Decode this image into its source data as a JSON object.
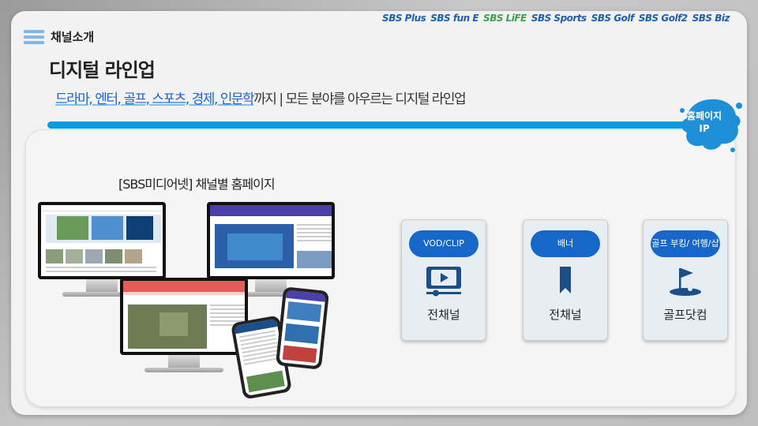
{
  "header": {
    "section_label": "채널소개",
    "title": "디지털 라인업",
    "subtitle_highlight": "드라마, 엔터, 골프, 스포츠, 경제, 인문학",
    "subtitle_rest": "까지 | 모든 분야를 아우르는 디지털 라인업"
  },
  "brands": [
    {
      "label": "SBS Plus",
      "color": "#1e5fb0"
    },
    {
      "label": "SBS fun E",
      "color": "#1e5fb0"
    },
    {
      "label": "SBS LiFE",
      "color": "#3aa34a"
    },
    {
      "label": "SBS Sports",
      "color": "#1e5fb0"
    },
    {
      "label": "SBS Golf",
      "color": "#1e5fb0"
    },
    {
      "label": "SBS Golf2",
      "color": "#1e5fb0"
    },
    {
      "label": "SBS Biz",
      "color": "#1e5fb0"
    }
  ],
  "badge": {
    "line1": "홈페이지",
    "line2": "IP"
  },
  "panel": {
    "heading": "[SBS미디어넷] 채널별 홈페이지"
  },
  "cards": [
    {
      "pill": "VOD/CLIP",
      "label": "전채널",
      "icon": "video-play-icon"
    },
    {
      "pill": "배너",
      "label": "전채널",
      "icon": "bookmark-icon"
    },
    {
      "pill": "골프 부킹/ 여행/샵",
      "label": "골프닷컴",
      "icon": "golf-flag-icon"
    }
  ],
  "colors": {
    "accent": "#1667c8",
    "bar": "#0a9ae0",
    "splash": "#1f8fd8"
  }
}
